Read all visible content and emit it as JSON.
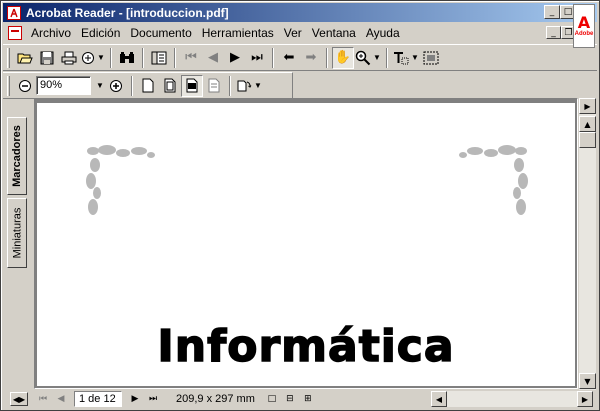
{
  "window": {
    "title": "Acrobat Reader - [introduccion.pdf]"
  },
  "menu": [
    {
      "label": "Archivo"
    },
    {
      "label": "Edición"
    },
    {
      "label": "Documento"
    },
    {
      "label": "Herramientas"
    },
    {
      "label": "Ver"
    },
    {
      "label": "Ventana"
    },
    {
      "label": "Ayuda"
    }
  ],
  "toolbar": {
    "zoom_value": "90%"
  },
  "sidebar": {
    "tabs": [
      {
        "label": "Marcadores",
        "active": true
      },
      {
        "label": "Miniaturas",
        "active": false
      }
    ]
  },
  "document": {
    "heading": "Informática"
  },
  "status": {
    "page_indicator": "1 de 12",
    "page_size": "209,9 x 297  mm"
  },
  "brand": {
    "logo_text": "Adobe",
    "accent": "#e00000",
    "title_gradient_start": "#0a246a",
    "title_gradient_end": "#a6caf0"
  },
  "icons": [
    "open-icon",
    "save-icon",
    "print-icon",
    "email-icon",
    "find-icon",
    "show-navigation-icon",
    "first-page-icon",
    "previous-page-icon",
    "next-page-icon",
    "last-page-icon",
    "go-back-icon",
    "go-forward-icon",
    "hand-tool-icon",
    "zoom-in-tool-icon",
    "text-select-tool-icon",
    "graphics-select-icon",
    "zoom-out-icon",
    "zoom-in-icon",
    "actual-size-icon",
    "fit-page-icon",
    "fit-width-icon",
    "fit-visible-icon",
    "rotate-icon"
  ]
}
